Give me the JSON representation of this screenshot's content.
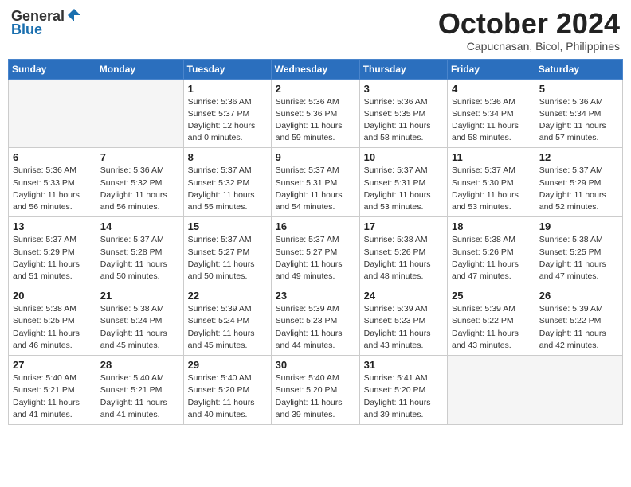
{
  "header": {
    "logo_line1": "General",
    "logo_line2": "Blue",
    "month": "October 2024",
    "location": "Capucnasan, Bicol, Philippines"
  },
  "weekdays": [
    "Sunday",
    "Monday",
    "Tuesday",
    "Wednesday",
    "Thursday",
    "Friday",
    "Saturday"
  ],
  "weeks": [
    [
      {
        "day": "",
        "sunrise": "",
        "sunset": "",
        "daylight": ""
      },
      {
        "day": "",
        "sunrise": "",
        "sunset": "",
        "daylight": ""
      },
      {
        "day": "1",
        "sunrise": "Sunrise: 5:36 AM",
        "sunset": "Sunset: 5:37 PM",
        "daylight": "Daylight: 12 hours and 0 minutes."
      },
      {
        "day": "2",
        "sunrise": "Sunrise: 5:36 AM",
        "sunset": "Sunset: 5:36 PM",
        "daylight": "Daylight: 11 hours and 59 minutes."
      },
      {
        "day": "3",
        "sunrise": "Sunrise: 5:36 AM",
        "sunset": "Sunset: 5:35 PM",
        "daylight": "Daylight: 11 hours and 58 minutes."
      },
      {
        "day": "4",
        "sunrise": "Sunrise: 5:36 AM",
        "sunset": "Sunset: 5:34 PM",
        "daylight": "Daylight: 11 hours and 58 minutes."
      },
      {
        "day": "5",
        "sunrise": "Sunrise: 5:36 AM",
        "sunset": "Sunset: 5:34 PM",
        "daylight": "Daylight: 11 hours and 57 minutes."
      }
    ],
    [
      {
        "day": "6",
        "sunrise": "Sunrise: 5:36 AM",
        "sunset": "Sunset: 5:33 PM",
        "daylight": "Daylight: 11 hours and 56 minutes."
      },
      {
        "day": "7",
        "sunrise": "Sunrise: 5:36 AM",
        "sunset": "Sunset: 5:32 PM",
        "daylight": "Daylight: 11 hours and 56 minutes."
      },
      {
        "day": "8",
        "sunrise": "Sunrise: 5:37 AM",
        "sunset": "Sunset: 5:32 PM",
        "daylight": "Daylight: 11 hours and 55 minutes."
      },
      {
        "day": "9",
        "sunrise": "Sunrise: 5:37 AM",
        "sunset": "Sunset: 5:31 PM",
        "daylight": "Daylight: 11 hours and 54 minutes."
      },
      {
        "day": "10",
        "sunrise": "Sunrise: 5:37 AM",
        "sunset": "Sunset: 5:31 PM",
        "daylight": "Daylight: 11 hours and 53 minutes."
      },
      {
        "day": "11",
        "sunrise": "Sunrise: 5:37 AM",
        "sunset": "Sunset: 5:30 PM",
        "daylight": "Daylight: 11 hours and 53 minutes."
      },
      {
        "day": "12",
        "sunrise": "Sunrise: 5:37 AM",
        "sunset": "Sunset: 5:29 PM",
        "daylight": "Daylight: 11 hours and 52 minutes."
      }
    ],
    [
      {
        "day": "13",
        "sunrise": "Sunrise: 5:37 AM",
        "sunset": "Sunset: 5:29 PM",
        "daylight": "Daylight: 11 hours and 51 minutes."
      },
      {
        "day": "14",
        "sunrise": "Sunrise: 5:37 AM",
        "sunset": "Sunset: 5:28 PM",
        "daylight": "Daylight: 11 hours and 50 minutes."
      },
      {
        "day": "15",
        "sunrise": "Sunrise: 5:37 AM",
        "sunset": "Sunset: 5:27 PM",
        "daylight": "Daylight: 11 hours and 50 minutes."
      },
      {
        "day": "16",
        "sunrise": "Sunrise: 5:37 AM",
        "sunset": "Sunset: 5:27 PM",
        "daylight": "Daylight: 11 hours and 49 minutes."
      },
      {
        "day": "17",
        "sunrise": "Sunrise: 5:38 AM",
        "sunset": "Sunset: 5:26 PM",
        "daylight": "Daylight: 11 hours and 48 minutes."
      },
      {
        "day": "18",
        "sunrise": "Sunrise: 5:38 AM",
        "sunset": "Sunset: 5:26 PM",
        "daylight": "Daylight: 11 hours and 47 minutes."
      },
      {
        "day": "19",
        "sunrise": "Sunrise: 5:38 AM",
        "sunset": "Sunset: 5:25 PM",
        "daylight": "Daylight: 11 hours and 47 minutes."
      }
    ],
    [
      {
        "day": "20",
        "sunrise": "Sunrise: 5:38 AM",
        "sunset": "Sunset: 5:25 PM",
        "daylight": "Daylight: 11 hours and 46 minutes."
      },
      {
        "day": "21",
        "sunrise": "Sunrise: 5:38 AM",
        "sunset": "Sunset: 5:24 PM",
        "daylight": "Daylight: 11 hours and 45 minutes."
      },
      {
        "day": "22",
        "sunrise": "Sunrise: 5:39 AM",
        "sunset": "Sunset: 5:24 PM",
        "daylight": "Daylight: 11 hours and 45 minutes."
      },
      {
        "day": "23",
        "sunrise": "Sunrise: 5:39 AM",
        "sunset": "Sunset: 5:23 PM",
        "daylight": "Daylight: 11 hours and 44 minutes."
      },
      {
        "day": "24",
        "sunrise": "Sunrise: 5:39 AM",
        "sunset": "Sunset: 5:23 PM",
        "daylight": "Daylight: 11 hours and 43 minutes."
      },
      {
        "day": "25",
        "sunrise": "Sunrise: 5:39 AM",
        "sunset": "Sunset: 5:22 PM",
        "daylight": "Daylight: 11 hours and 43 minutes."
      },
      {
        "day": "26",
        "sunrise": "Sunrise: 5:39 AM",
        "sunset": "Sunset: 5:22 PM",
        "daylight": "Daylight: 11 hours and 42 minutes."
      }
    ],
    [
      {
        "day": "27",
        "sunrise": "Sunrise: 5:40 AM",
        "sunset": "Sunset: 5:21 PM",
        "daylight": "Daylight: 11 hours and 41 minutes."
      },
      {
        "day": "28",
        "sunrise": "Sunrise: 5:40 AM",
        "sunset": "Sunset: 5:21 PM",
        "daylight": "Daylight: 11 hours and 41 minutes."
      },
      {
        "day": "29",
        "sunrise": "Sunrise: 5:40 AM",
        "sunset": "Sunset: 5:20 PM",
        "daylight": "Daylight: 11 hours and 40 minutes."
      },
      {
        "day": "30",
        "sunrise": "Sunrise: 5:40 AM",
        "sunset": "Sunset: 5:20 PM",
        "daylight": "Daylight: 11 hours and 39 minutes."
      },
      {
        "day": "31",
        "sunrise": "Sunrise: 5:41 AM",
        "sunset": "Sunset: 5:20 PM",
        "daylight": "Daylight: 11 hours and 39 minutes."
      },
      {
        "day": "",
        "sunrise": "",
        "sunset": "",
        "daylight": ""
      },
      {
        "day": "",
        "sunrise": "",
        "sunset": "",
        "daylight": ""
      }
    ]
  ]
}
